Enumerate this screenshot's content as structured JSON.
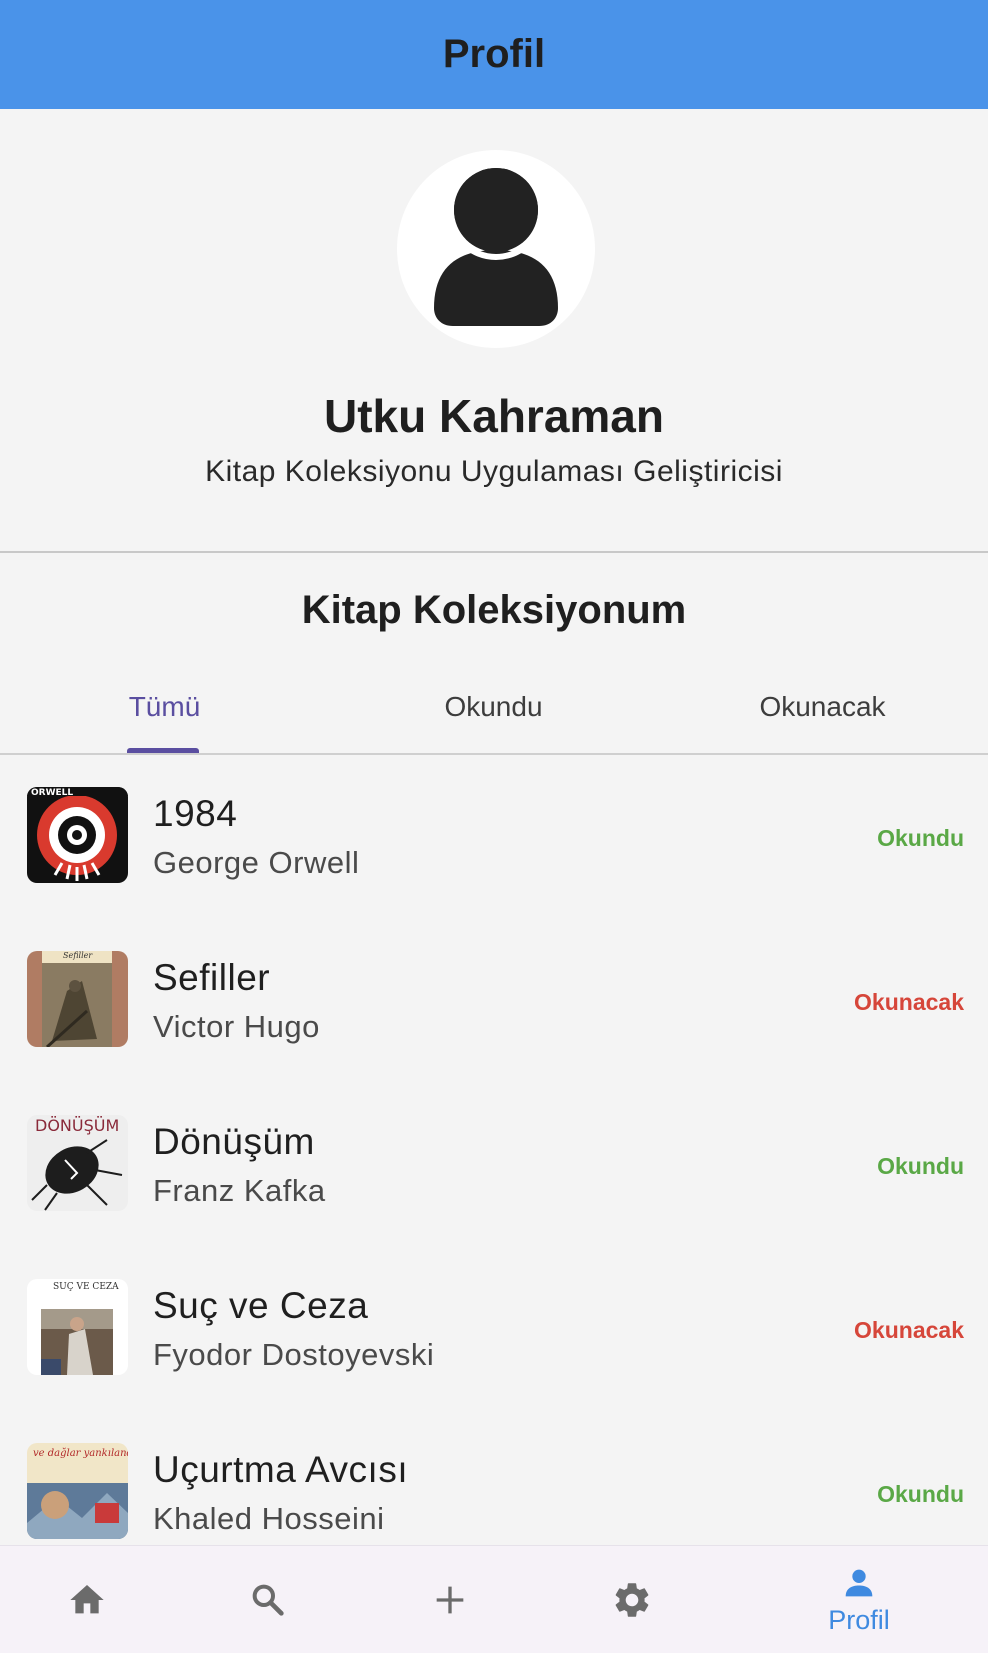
{
  "appbar": {
    "title": "Profil",
    "color": "#4a93e9"
  },
  "profile": {
    "avatar_icon": "person-icon",
    "name": "Utku Kahraman",
    "role": "Kitap Koleksiyonu Uygulaması Geliştiricisi"
  },
  "collection": {
    "title": "Kitap Koleksiyonum",
    "tabs": [
      {
        "label": "Tümü",
        "active": true
      },
      {
        "label": "Okundu",
        "active": false
      },
      {
        "label": "Okunacak",
        "active": false
      }
    ],
    "accent_color": "#5a4ea0"
  },
  "books": [
    {
      "title": "1984",
      "author": "George Orwell",
      "status": "Okundu",
      "status_color": "#5aa846",
      "cover_text": "ORWELL"
    },
    {
      "title": "Sefiller",
      "author": "Victor Hugo",
      "status": "Okunacak",
      "status_color": "#d6463a",
      "cover_text": "Sefiller"
    },
    {
      "title": "Dönüşüm",
      "author": "Franz Kafka",
      "status": "Okundu",
      "status_color": "#5aa846",
      "cover_text": "DÖNÜŞÜM"
    },
    {
      "title": "Suç ve Ceza",
      "author": "Fyodor Dostoyevski",
      "status": "Okunacak",
      "status_color": "#d6463a",
      "cover_text": "SUÇ VE CEZA"
    },
    {
      "title": "Uçurtma Avcısı",
      "author": "Khaled Hosseini",
      "status": "Okundu",
      "status_color": "#5aa846",
      "cover_text": "ve dağlar yankılandı"
    }
  ],
  "bottom_nav": {
    "items": [
      {
        "icon": "home-icon",
        "label": ""
      },
      {
        "icon": "search-icon",
        "label": ""
      },
      {
        "icon": "add-icon",
        "label": ""
      },
      {
        "icon": "settings-icon",
        "label": ""
      },
      {
        "icon": "person-icon",
        "label": "Profil",
        "active": true
      }
    ],
    "active_color": "#3f8ae0",
    "inactive_color": "#6b6b6b"
  }
}
